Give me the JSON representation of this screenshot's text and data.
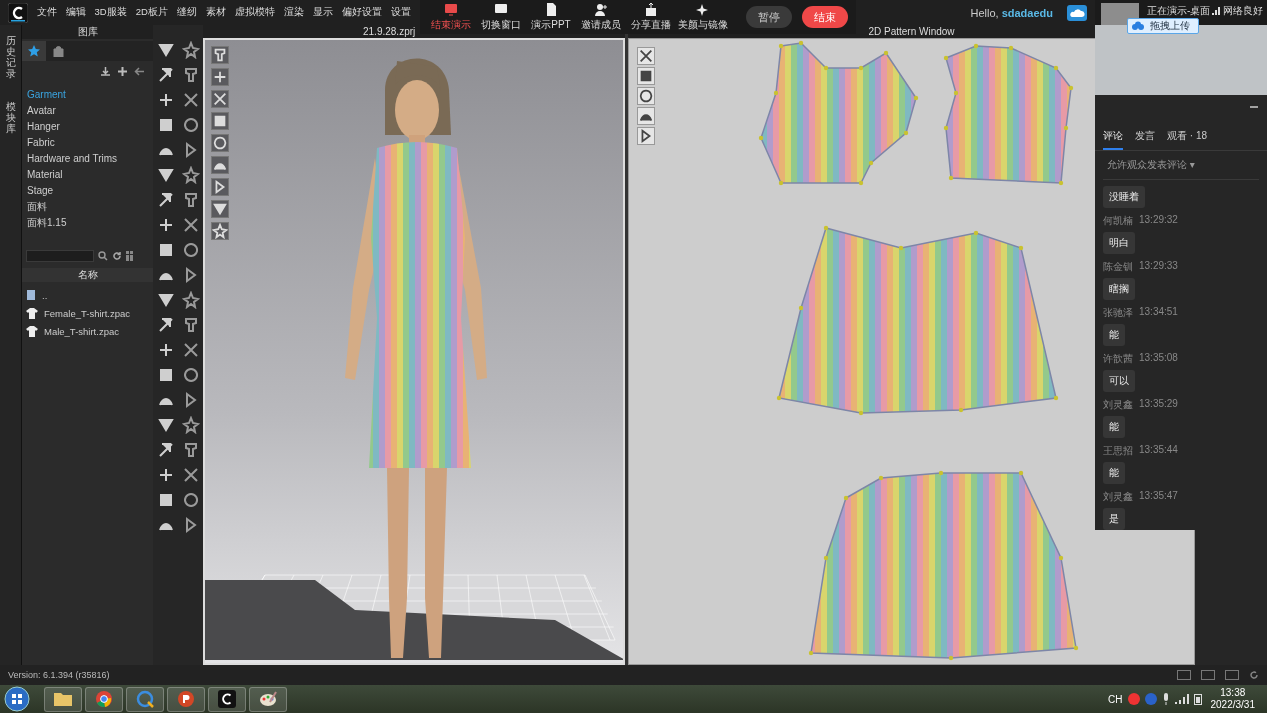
{
  "app": {
    "menu": [
      "文件",
      "编辑",
      "3D服装",
      "2D板片",
      "缝纫",
      "素材",
      "虚拟模特",
      "渲染",
      "显示",
      "偏好设置",
      "设置"
    ],
    "greeting": "Hello,",
    "user": "sdadaedu",
    "version": "Version: 6.1.394 (r35816)"
  },
  "side_tabs": [
    "历史记录",
    "模块库"
  ],
  "library": {
    "title": "图库",
    "tabs": [
      {
        "kind": "favorites",
        "selected": true
      },
      {
        "kind": "bag",
        "selected": false
      }
    ],
    "items": [
      {
        "label": "Garment",
        "selected": true
      },
      {
        "label": "Avatar",
        "selected": false
      },
      {
        "label": "Hanger",
        "selected": false
      },
      {
        "label": "Fabric",
        "selected": false
      },
      {
        "label": "Hardware and Trims",
        "selected": false
      },
      {
        "label": "Material",
        "selected": false
      },
      {
        "label": "Stage",
        "selected": false
      },
      {
        "label": "面料",
        "selected": false
      },
      {
        "label": "面料1.15",
        "selected": false
      }
    ],
    "list_header": "名称",
    "files": [
      {
        "kind": "folder",
        "name": ".."
      },
      {
        "kind": "garment",
        "name": "Female_T-shirt.zpac"
      },
      {
        "kind": "garment",
        "name": "Male_T-shirt.zpac"
      }
    ]
  },
  "viewport_3d": {
    "title": "21.9.28.zprj"
  },
  "pattern_window": {
    "title": "2D Pattern Window"
  },
  "meeting_toolbar": {
    "actions": [
      {
        "kind": "stop_share",
        "label": "结束演示"
      },
      {
        "kind": "switch_window",
        "label": "切换窗口"
      },
      {
        "kind": "slides",
        "label": "演示PPT"
      },
      {
        "kind": "invite",
        "label": "邀请成员"
      },
      {
        "kind": "live",
        "label": "分享直播"
      },
      {
        "kind": "beauty",
        "label": "美颜与镜像"
      }
    ],
    "buttons": [
      {
        "kind": "pause",
        "label": "暂停"
      },
      {
        "kind": "end",
        "label": "结束"
      }
    ]
  },
  "presenting": {
    "status": "正在演示-桌面",
    "network": "网络良好",
    "upload_button": "拖拽上传"
  },
  "comments": {
    "tabs": [
      {
        "label": "评论",
        "selected": true
      },
      {
        "label": "发言",
        "selected": false
      },
      {
        "label": "观看 · 18",
        "selected": false
      }
    ],
    "filter": "允许观众发表评论 ▾",
    "messages": [
      {
        "text": "没睡着"
      },
      {
        "author": "何凯楠",
        "time": "13:29:32",
        "text": "明白"
      },
      {
        "author": "陈金钏",
        "time": "13:29:33",
        "text": "瞎搁"
      },
      {
        "author": "张驰泽",
        "time": "13:34:51",
        "text": "能"
      },
      {
        "author": "许歆茜",
        "time": "13:35:08",
        "text": "可以"
      },
      {
        "author": "刘灵鑫",
        "time": "13:35:29",
        "text": "能"
      },
      {
        "author": "王思招",
        "time": "13:35:44",
        "text": "能"
      },
      {
        "author": "刘灵鑫",
        "time": "13:35:47",
        "text": "是"
      }
    ]
  },
  "taskbar": {
    "apps": [
      {
        "kind": "folder"
      },
      {
        "kind": "chrome"
      },
      {
        "kind": "browser"
      },
      {
        "kind": "slides"
      },
      {
        "kind": "clo"
      },
      {
        "kind": "paint"
      }
    ],
    "language": "CH",
    "time": "13:38",
    "date": "2022/3/31"
  }
}
